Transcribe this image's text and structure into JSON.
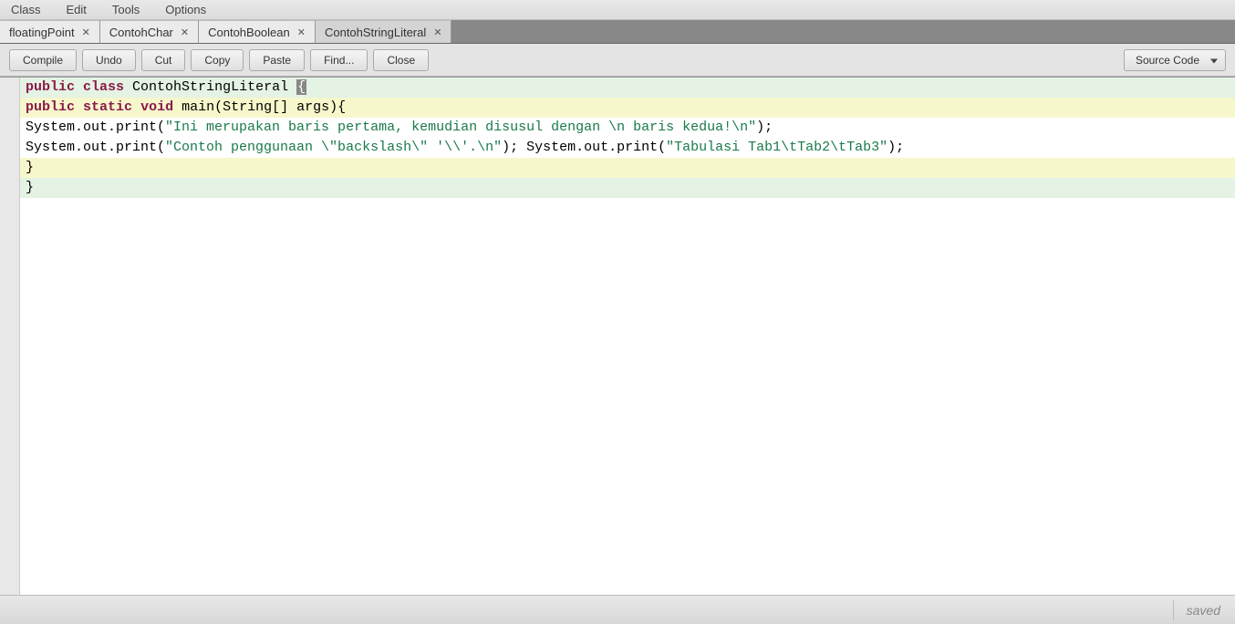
{
  "menu": {
    "class": "Class",
    "edit": "Edit",
    "tools": "Tools",
    "options": "Options"
  },
  "tabs": [
    {
      "label": "floatingPoint",
      "active": false
    },
    {
      "label": "ContohChar",
      "active": false
    },
    {
      "label": "ContohBoolean",
      "active": false
    },
    {
      "label": "ContohStringLiteral",
      "active": true
    }
  ],
  "toolbar": {
    "compile": "Compile",
    "undo": "Undo",
    "cut": "Cut",
    "copy": "Copy",
    "paste": "Paste",
    "find": "Find...",
    "close": "Close",
    "view_mode": "Source Code"
  },
  "code": {
    "l1_kw1": "public",
    "l1_kw2": "class",
    "l1_rest": " ContohStringLiteral ",
    "l1_brace": "{",
    "l2_kw1": "public",
    "l2_kw2": "static",
    "l2_kw3": "void",
    "l2_rest": " main(String[] args){",
    "l3_a": "System.out.print(",
    "l3_str": "\"Ini merupakan baris pertama, kemudian disusul dengan \\n baris kedua!\\n\"",
    "l3_b": ");",
    "l4_a": "System.out.print(",
    "l4_str1": "\"Contoh penggunaan \\\"backslash\\\" '\\\\'.\\n\"",
    "l4_b": "); System.out.print(",
    "l4_str2": "\"Tabulasi Tab1\\tTab2\\tTab3\"",
    "l4_c": ");",
    "l5": "}",
    "l6": "}"
  },
  "status": {
    "saved": "saved"
  }
}
